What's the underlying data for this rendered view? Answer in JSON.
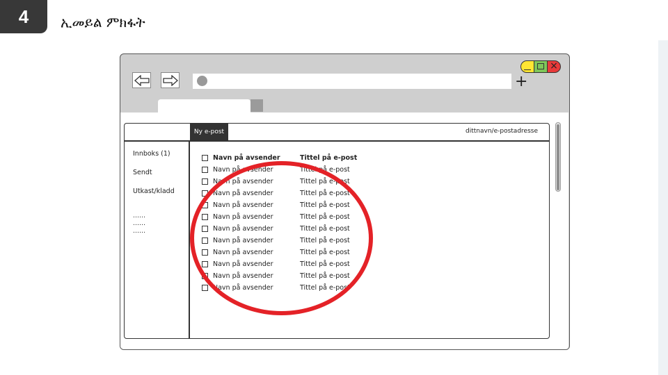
{
  "slide": {
    "step_number": "4",
    "title": "ኢመይል ምክፋት"
  },
  "browser": {
    "new_tab_symbol": "+",
    "close_symbol": "×",
    "icons": {
      "back": "arrow-left-icon",
      "forward": "arrow-right-icon"
    }
  },
  "mail": {
    "compose_label": "Ny e-post",
    "account": "dittnavn/e-postadresse",
    "folders": [
      {
        "label": "Innboks (1)"
      },
      {
        "label": "Sendt"
      },
      {
        "label": "Utkast/kladd"
      }
    ],
    "placeholder_lines": [
      "……",
      "……",
      "……"
    ],
    "messages": [
      {
        "sender": "Navn på avsender",
        "subject": "Tittel på e-post",
        "unread": true
      },
      {
        "sender": "Navn på avsender",
        "subject": "Tittel på e-post",
        "unread": false
      },
      {
        "sender": "Navn på avsender",
        "subject": "Tittel på e-post",
        "unread": false
      },
      {
        "sender": "Navn på avsender",
        "subject": "Tittel på e-post",
        "unread": false
      },
      {
        "sender": "Navn på avsender",
        "subject": "Tittel på e-post",
        "unread": false
      },
      {
        "sender": "Navn på avsender",
        "subject": "Tittel på e-post",
        "unread": false
      },
      {
        "sender": "Navn på avsender",
        "subject": "Tittel på e-post",
        "unread": false
      },
      {
        "sender": "Navn på avsender",
        "subject": "Tittel på e-post",
        "unread": false
      },
      {
        "sender": "Navn på avsender",
        "subject": "Tittel på e-post",
        "unread": false
      },
      {
        "sender": "Navn på avsender",
        "subject": "Tittel på e-post",
        "unread": false
      },
      {
        "sender": "Navn på avsender",
        "subject": "Tittel på e-post",
        "unread": false
      },
      {
        "sender": "Navn på avsender",
        "subject": "Tittel på e-post",
        "unread": false
      }
    ]
  },
  "colors": {
    "highlight_circle": "#e42227",
    "window_chrome": "#cfcfcf",
    "minimize": "#ffe633",
    "maximize": "#7fc65a",
    "close": "#e83a3a"
  }
}
